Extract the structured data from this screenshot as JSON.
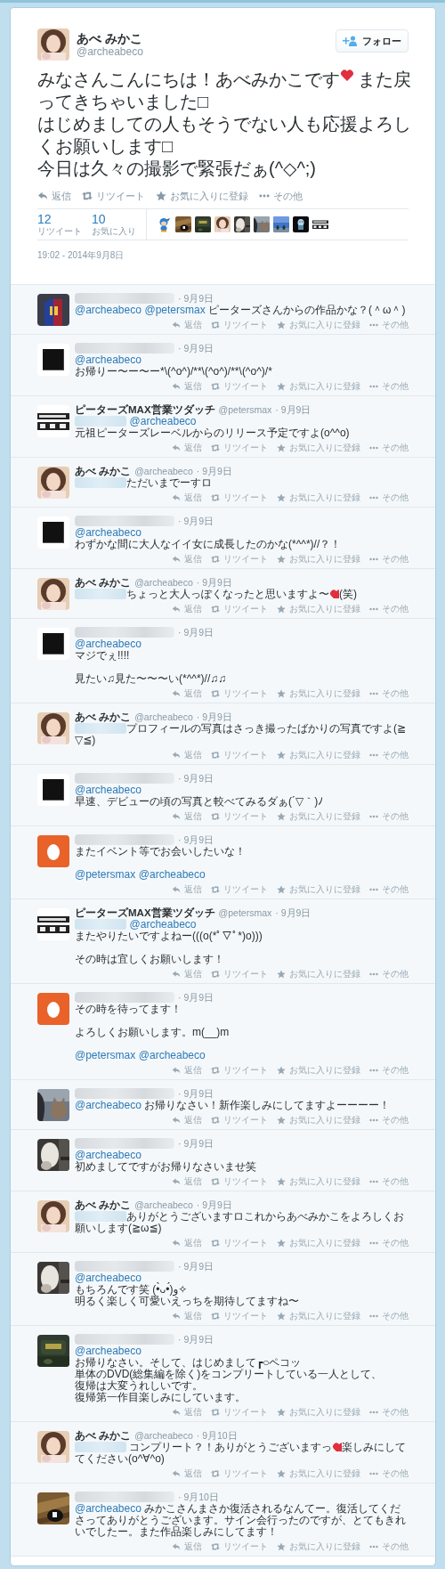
{
  "tweet": {
    "author": {
      "name": "あべ みかこ",
      "handle": "@archeabeco",
      "avatar": {
        "kind": "woman"
      }
    },
    "follow_button": "フォロー",
    "paragraphs": [
      {
        "lines": [
          {
            "parts": [
              {
                "kind": "text",
                "text": "みなさんこんにちは！あべみかこです"
              },
              {
                "kind": "heart"
              },
              {
                "kind": "text",
                "text": "また戻ってきちゃいました□"
              }
            ]
          },
          {
            "parts": [
              {
                "kind": "text",
                "text": "はじめましての人もそうでない人も応援よろしくお願いします□"
              }
            ]
          },
          {
            "parts": [
              {
                "kind": "text",
                "text": "今日は久々の撮影で緊張だぁ(^◇^;)"
              }
            ]
          }
        ]
      }
    ],
    "actions": [
      "返信",
      "リツイート",
      "お気に入りに登録",
      "その他"
    ],
    "stats": [
      {
        "count": "12",
        "label": "リツイート"
      },
      {
        "count": "10",
        "label": "お気に入り"
      }
    ],
    "favoriters": [
      {
        "kind": "figure"
      },
      {
        "kind": "cat2"
      },
      {
        "kind": "cap"
      },
      {
        "kind": "woman"
      },
      {
        "kind": "alpaca"
      },
      {
        "kind": "cat"
      },
      {
        "kind": "sky"
      },
      {
        "kind": "dark"
      },
      {
        "kind": "logo"
      }
    ],
    "timestamp": "19:02 - 2014年9月8日"
  },
  "replies": [
    {
      "author": {
        "redacted": true
      },
      "avatar": {
        "kind": "jersey"
      },
      "date": "· 9月9日",
      "paragraphs": [
        {
          "lines": [
            {
              "parts": [
                {
                  "kind": "mention",
                  "text": "@archeabeco"
                },
                {
                  "kind": "mention",
                  "text": "@petersmax"
                },
                {
                  "kind": "text",
                  "text": " ピーターズさんからの作品かな？(＾ω＾)"
                }
              ]
            }
          ]
        }
      ],
      "actions": [
        "返信",
        "リツイート",
        "お気に入りに登録",
        "その他"
      ]
    },
    {
      "author": {
        "redacted": true
      },
      "avatar": {
        "kind": "black"
      },
      "date": "· 9月9日",
      "paragraphs": [
        {
          "lines": [
            {
              "parts": [
                {
                  "kind": "mention",
                  "text": "@archeabeco"
                }
              ]
            },
            {
              "parts": [
                {
                  "kind": "text",
                  "text": "お帰りー〜ー〜ー*\\(^o^)/**\\(^o^)/**\\(^o^)/*"
                }
              ]
            }
          ]
        }
      ],
      "actions": [
        "返信",
        "リツイート",
        "お気に入りに登録",
        "その他"
      ]
    },
    {
      "author": {
        "name": "ピーターズMAX営業ツダッチ",
        "handle": "@petersmax"
      },
      "avatar": {
        "kind": "logo"
      },
      "date": "· 9月9日",
      "paragraphs": [
        {
          "lines": [
            {
              "parts": [
                {
                  "kind": "redacted"
                },
                {
                  "kind": "mention",
                  "text": "@archeabeco"
                }
              ]
            },
            {
              "parts": [
                {
                  "kind": "text",
                  "text": "元祖ピーターズレーベルからのリリース予定ですよ(o^^o)"
                }
              ]
            }
          ]
        }
      ],
      "actions": [
        "返信",
        "リツイート",
        "お気に入りに登録",
        "その他"
      ]
    },
    {
      "author": {
        "name": "あべ みかこ",
        "handle": "@archeabeco"
      },
      "avatar": {
        "kind": "woman"
      },
      "date": "· 9月9日",
      "paragraphs": [
        {
          "lines": [
            {
              "parts": [
                {
                  "kind": "redacted"
                },
                {
                  "kind": "text",
                  "text": "ただいまでーすロ"
                }
              ]
            }
          ]
        }
      ],
      "actions": [
        "返信",
        "リツイート",
        "お気に入りに登録",
        "その他"
      ]
    },
    {
      "author": {
        "redacted": true
      },
      "avatar": {
        "kind": "black"
      },
      "date": "· 9月9日",
      "paragraphs": [
        {
          "lines": [
            {
              "parts": [
                {
                  "kind": "mention",
                  "text": "@archeabeco"
                }
              ]
            },
            {
              "parts": [
                {
                  "kind": "text",
                  "text": "わずかな間に大人なイイ女に成長したのかな(*^^*)//？！"
                }
              ]
            }
          ]
        }
      ],
      "actions": [
        "返信",
        "リツイート",
        "お気に入りに登録",
        "その他"
      ]
    },
    {
      "author": {
        "name": "あべ みかこ",
        "handle": "@archeabeco"
      },
      "avatar": {
        "kind": "woman"
      },
      "date": "· 9月9日",
      "paragraphs": [
        {
          "lines": [
            {
              "parts": [
                {
                  "kind": "redacted"
                },
                {
                  "kind": "text",
                  "text": "ちょっと大人っぽくなったと思いますよ〜"
                },
                {
                  "kind": "heart"
                },
                {
                  "kind": "text",
                  "text": "(笑)"
                }
              ]
            }
          ]
        }
      ],
      "actions": [
        "返信",
        "リツイート",
        "お気に入りに登録",
        "その他"
      ]
    },
    {
      "author": {
        "redacted": true
      },
      "avatar": {
        "kind": "black"
      },
      "date": "· 9月9日",
      "paragraphs": [
        {
          "lines": [
            {
              "parts": [
                {
                  "kind": "mention",
                  "text": "@archeabeco"
                }
              ]
            },
            {
              "parts": [
                {
                  "kind": "text",
                  "text": "マジでぇ!!!!"
                }
              ]
            }
          ]
        },
        {
          "lines": [
            {
              "parts": [
                {
                  "kind": "text",
                  "text": "見たい♫見た〜〜〜い(*^^*)//♫♫"
                }
              ]
            }
          ]
        }
      ],
      "actions": [
        "返信",
        "リツイート",
        "お気に入りに登録",
        "その他"
      ]
    },
    {
      "author": {
        "name": "あべ みかこ",
        "handle": "@archeabeco"
      },
      "avatar": {
        "kind": "woman"
      },
      "date": "· 9月9日",
      "paragraphs": [
        {
          "lines": [
            {
              "parts": [
                {
                  "kind": "redacted"
                },
                {
                  "kind": "text",
                  "text": "プロフィールの写真はさっき撮ったばかりの写真ですよ(≧▽≦)"
                }
              ]
            }
          ]
        }
      ],
      "actions": [
        "返信",
        "リツイート",
        "お気に入りに登録",
        "その他"
      ]
    },
    {
      "author": {
        "redacted": true
      },
      "avatar": {
        "kind": "black"
      },
      "date": "· 9月9日",
      "paragraphs": [
        {
          "lines": [
            {
              "parts": [
                {
                  "kind": "mention",
                  "text": "@archeabeco"
                }
              ]
            },
            {
              "parts": [
                {
                  "kind": "text",
                  "text": "早速、デビューの頃の写真と較べてみるダぁ(´▽｀)ﾉ"
                }
              ]
            }
          ]
        }
      ],
      "actions": [
        "返信",
        "リツイート",
        "お気に入りに登録",
        "その他"
      ]
    },
    {
      "author": {
        "redacted": true
      },
      "avatar": {
        "kind": "egg"
      },
      "date": "· 9月9日",
      "paragraphs": [
        {
          "lines": [
            {
              "parts": [
                {
                  "kind": "text",
                  "text": "またイベント等でお会いしたいな！"
                }
              ]
            }
          ]
        },
        {
          "lines": [
            {
              "parts": [
                {
                  "kind": "mention",
                  "text": "@petersmax"
                },
                {
                  "kind": "mention",
                  "text": "@archeabeco"
                }
              ]
            }
          ]
        }
      ],
      "actions": [
        "返信",
        "リツイート",
        "お気に入りに登録",
        "その他"
      ]
    },
    {
      "author": {
        "name": "ピーターズMAX営業ツダッチ",
        "handle": "@petersmax"
      },
      "avatar": {
        "kind": "logo"
      },
      "date": "· 9月9日",
      "paragraphs": [
        {
          "lines": [
            {
              "parts": [
                {
                  "kind": "redacted"
                },
                {
                  "kind": "mention",
                  "text": "@archeabeco"
                }
              ]
            },
            {
              "parts": [
                {
                  "kind": "text",
                  "text": "またやりたいですよねー(((o(*ﾟ▽ﾟ*)o)))"
                }
              ]
            }
          ]
        },
        {
          "lines": [
            {
              "parts": [
                {
                  "kind": "text",
                  "text": "その時は宜しくお願いします！"
                }
              ]
            }
          ]
        }
      ],
      "actions": [
        "返信",
        "リツイート",
        "お気に入りに登録",
        "その他"
      ]
    },
    {
      "author": {
        "redacted": true
      },
      "avatar": {
        "kind": "egg"
      },
      "date": "· 9月9日",
      "paragraphs": [
        {
          "lines": [
            {
              "parts": [
                {
                  "kind": "text",
                  "text": "その時を待ってます！"
                }
              ]
            }
          ]
        },
        {
          "lines": [
            {
              "parts": [
                {
                  "kind": "text",
                  "text": "よろしくお願いします。m(__)m"
                }
              ]
            }
          ]
        },
        {
          "lines": [
            {
              "parts": [
                {
                  "kind": "mention",
                  "text": "@petersmax"
                },
                {
                  "kind": "mention",
                  "text": "@archeabeco"
                }
              ]
            }
          ]
        }
      ],
      "actions": [
        "返信",
        "リツイート",
        "お気に入りに登録",
        "その他"
      ]
    },
    {
      "author": {
        "redacted": true
      },
      "avatar": {
        "kind": "cat"
      },
      "date": "· 9月9日",
      "paragraphs": [
        {
          "lines": [
            {
              "parts": [
                {
                  "kind": "mention",
                  "text": "@archeabeco"
                },
                {
                  "kind": "text",
                  "text": " お帰りなさい！新作楽しみにしてますよーーーー！"
                }
              ]
            }
          ]
        }
      ],
      "actions": [
        "返信",
        "リツイート",
        "お気に入りに登録",
        "その他"
      ]
    },
    {
      "author": {
        "redacted": true
      },
      "avatar": {
        "kind": "alpaca"
      },
      "date": "· 9月9日",
      "paragraphs": [
        {
          "lines": [
            {
              "parts": [
                {
                  "kind": "mention",
                  "text": "@archeabeco"
                }
              ]
            },
            {
              "parts": [
                {
                  "kind": "text",
                  "text": "初めましてですがお帰りなさいませ笑"
                }
              ]
            }
          ]
        }
      ],
      "actions": [
        "返信",
        "リツイート",
        "お気に入りに登録",
        "その他"
      ]
    },
    {
      "author": {
        "name": "あべ みかこ",
        "handle": "@archeabeco"
      },
      "avatar": {
        "kind": "woman"
      },
      "date": "· 9月9日",
      "paragraphs": [
        {
          "lines": [
            {
              "parts": [
                {
                  "kind": "redacted"
                },
                {
                  "kind": "text",
                  "text": "ありがとうございますロこれからあべみかこをよろしくお願いします(≧ω≦)"
                }
              ]
            }
          ]
        }
      ],
      "actions": [
        "返信",
        "リツイート",
        "お気に入りに登録",
        "その他"
      ]
    },
    {
      "author": {
        "redacted": true
      },
      "avatar": {
        "kind": "alpaca"
      },
      "date": "· 9月9日",
      "paragraphs": [
        {
          "lines": [
            {
              "parts": [
                {
                  "kind": "mention",
                  "text": "@archeabeco"
                }
              ]
            },
            {
              "parts": [
                {
                  "kind": "text",
                  "text": "もちろんです笑 (•̀ᴗ•́)و✧"
                }
              ]
            },
            {
              "parts": [
                {
                  "kind": "text",
                  "text": "明るく楽しく可愛いえっちを期待してますね〜"
                }
              ]
            }
          ]
        }
      ],
      "actions": [
        "返信",
        "リツイート",
        "お気に入りに登録",
        "その他"
      ]
    },
    {
      "author": {
        "redacted": true
      },
      "avatar": {
        "kind": "cap"
      },
      "date": "· 9月9日",
      "paragraphs": [
        {
          "lines": [
            {
              "parts": [
                {
                  "kind": "mention",
                  "text": "@archeabeco"
                }
              ]
            },
            {
              "parts": [
                {
                  "kind": "text",
                  "text": "お帰りなさい。そして、はじめまして┏○ペコッ"
                }
              ]
            },
            {
              "parts": [
                {
                  "kind": "text",
                  "text": "単体のDVD(総集編を除く)をコンプリートしている一人として、"
                }
              ]
            },
            {
              "parts": [
                {
                  "kind": "text",
                  "text": "復帰は大変うれしいです。"
                }
              ]
            },
            {
              "parts": [
                {
                  "kind": "text",
                  "text": "復帰第一作目楽しみにしています。"
                }
              ]
            }
          ]
        }
      ],
      "actions": [
        "返信",
        "リツイート",
        "お気に入りに登録",
        "その他"
      ]
    },
    {
      "author": {
        "name": "あべ みかこ",
        "handle": "@archeabeco"
      },
      "avatar": {
        "kind": "woman"
      },
      "date": "· 9月10日",
      "paragraphs": [
        {
          "lines": [
            {
              "parts": [
                {
                  "kind": "redacted"
                },
                {
                  "kind": "text",
                  "text": " コンプリート？！ありがとうございますっ"
                },
                {
                  "kind": "heart"
                },
                {
                  "kind": "text",
                  "text": "楽しみにしててください(o^∀^o)"
                }
              ]
            }
          ]
        }
      ],
      "actions": [
        "返信",
        "リツイート",
        "お気に入りに登録",
        "その他"
      ]
    },
    {
      "author": {
        "redacted": true
      },
      "avatar": {
        "kind": "cat2"
      },
      "date": "· 9月10日",
      "paragraphs": [
        {
          "lines": [
            {
              "parts": [
                {
                  "kind": "mention",
                  "text": "@archeabeco"
                },
                {
                  "kind": "text",
                  "text": " みかこさんまさか復活されるなんてー。復活してくださってありがとうございます。サイン会行ったのですが、とてもきれいでしたー。また作品楽しみにしてます！"
                }
              ]
            }
          ]
        }
      ],
      "actions": [
        "返信",
        "リツイート",
        "お気に入りに登録",
        "その他"
      ]
    }
  ]
}
